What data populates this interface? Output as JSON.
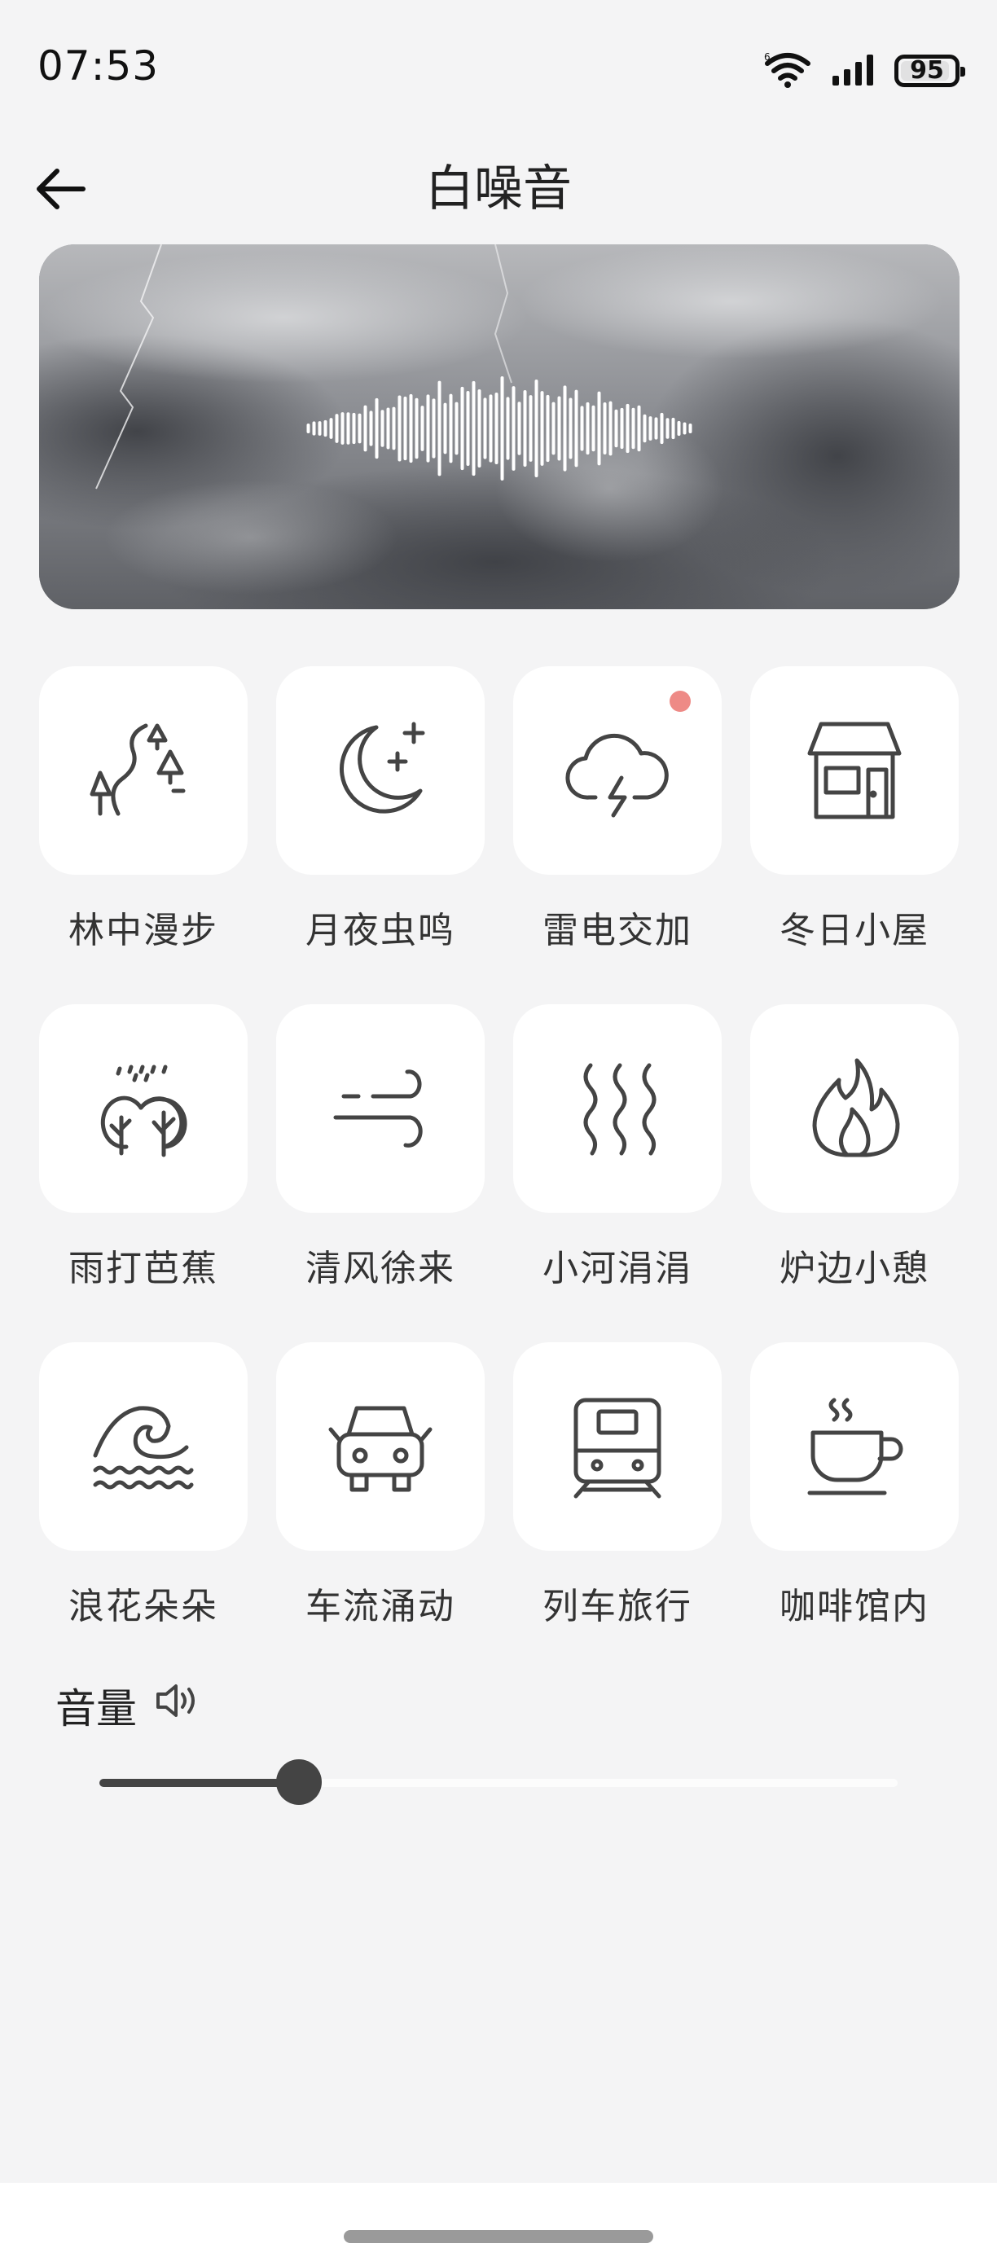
{
  "status_bar": {
    "time": "07:53",
    "battery": "95"
  },
  "header": {
    "title": "白噪音"
  },
  "sounds": [
    {
      "label": "林中漫步",
      "icon": "forest-path-icon"
    },
    {
      "label": "月夜虫鸣",
      "icon": "moon-stars-icon"
    },
    {
      "label": "雷电交加",
      "icon": "thunder-cloud-icon",
      "new_badge": true
    },
    {
      "label": "冬日小屋",
      "icon": "house-icon"
    },
    {
      "label": "雨打芭蕉",
      "icon": "rain-trees-icon"
    },
    {
      "label": "清风徐来",
      "icon": "wind-icon"
    },
    {
      "label": "小河涓涓",
      "icon": "stream-icon"
    },
    {
      "label": "炉边小憩",
      "icon": "fire-icon"
    },
    {
      "label": "浪花朵朵",
      "icon": "wave-icon"
    },
    {
      "label": "车流涌动",
      "icon": "car-icon"
    },
    {
      "label": "列车旅行",
      "icon": "train-icon"
    },
    {
      "label": "咖啡馆内",
      "icon": "coffee-cup-icon"
    }
  ],
  "volume": {
    "label": "音量",
    "level": 0.25
  },
  "colors": {
    "background": "#f4f4f5",
    "card": "#ffffff",
    "icon": "#444444",
    "badge": "#ee8a86"
  }
}
